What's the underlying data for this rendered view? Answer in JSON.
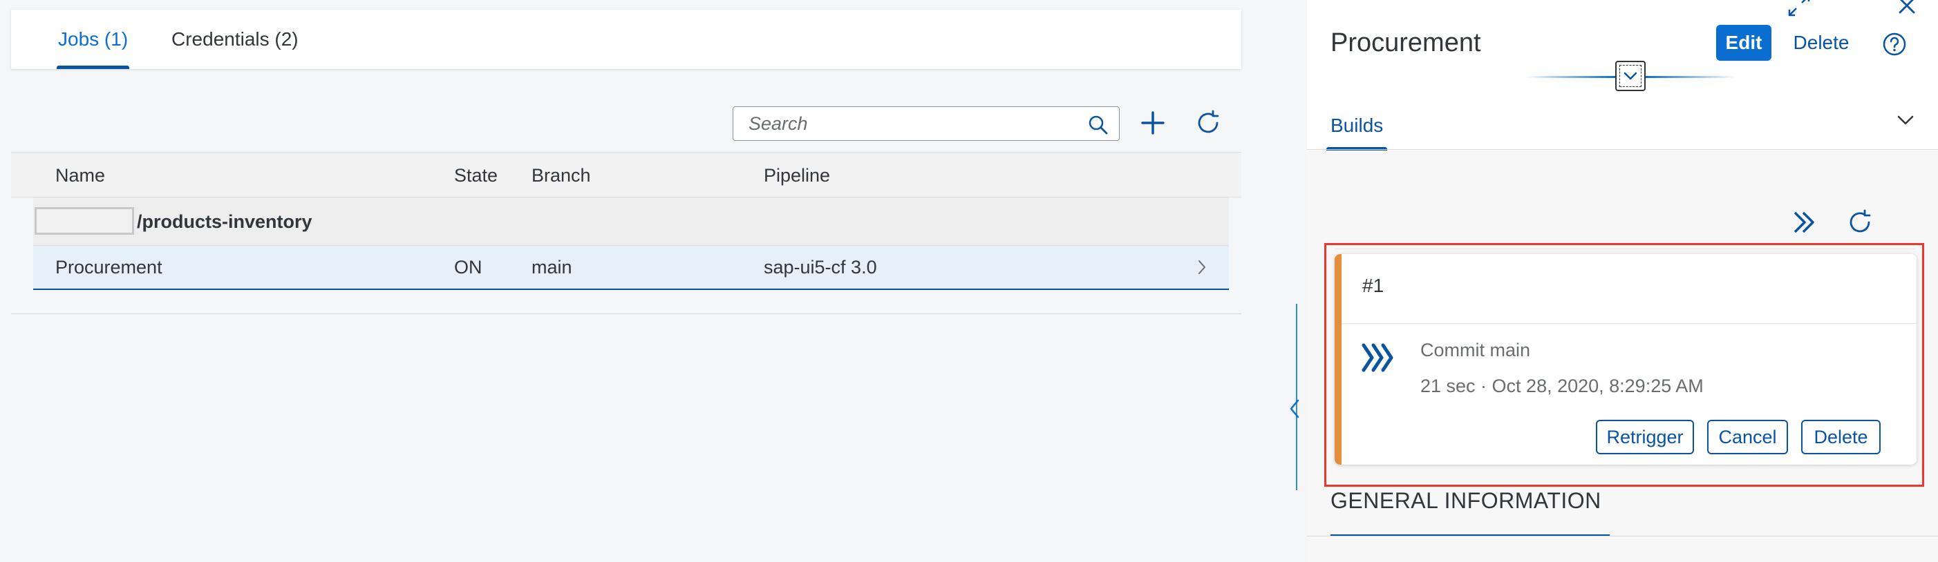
{
  "tabs": {
    "jobs": "Jobs (1)",
    "credentials": "Credentials (2)"
  },
  "search": {
    "placeholder": "Search",
    "value": ""
  },
  "table": {
    "columns": {
      "name": "Name",
      "state": "State",
      "branch": "Branch",
      "pipeline": "Pipeline"
    },
    "group": "/products-inventory",
    "row": {
      "name": "Procurement",
      "state": "ON",
      "branch": "main",
      "pipeline": "sap-ui5-cf 3.0"
    }
  },
  "detail": {
    "title": "Procurement",
    "edit_label": "Edit",
    "delete_label": "Delete",
    "tab_builds": "Builds",
    "build": {
      "number": "#1",
      "status_color": "#e78c3a",
      "commit": "Commit main",
      "meta": "21 sec · Oct 28, 2020, 8:29:25 AM",
      "retrigger_label": "Retrigger",
      "cancel_label": "Cancel",
      "delete_label": "Delete"
    },
    "section_title": "GENERAL INFORMATION"
  },
  "colors": {
    "brand": "#0a6ed1",
    "brand_dark": "#0854a0",
    "selected_row": "#e5f0fa",
    "highlight": "#e8392c"
  },
  "icons": {
    "search": "search-icon",
    "add": "add-icon",
    "refresh": "refresh-icon",
    "row_nav": "chevron-right-icon",
    "splitter": "chevron-left-icon",
    "fullscreen": "fullscreen-icon",
    "close": "close-icon",
    "help": "help-icon",
    "collapse": "chevron-down-icon",
    "run": "run-icon",
    "stage": "stage-progress-icon"
  }
}
